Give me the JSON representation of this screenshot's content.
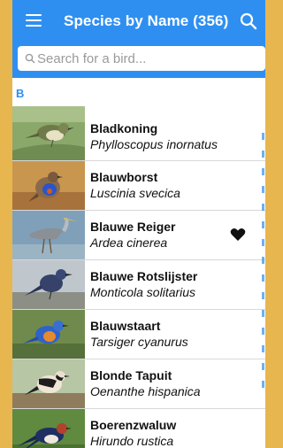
{
  "appbar": {
    "title": "Species by Name (356)",
    "menu_icon": "hamburger-menu-icon",
    "search_icon": "search-icon"
  },
  "search": {
    "placeholder": "Search for a bird..."
  },
  "section": {
    "letter": "B"
  },
  "colors": {
    "accent": "#2f8ff0",
    "background_edge": "#e8b64f"
  },
  "species": [
    {
      "name": "Bladkoning",
      "scientific": "Phylloscopus inornatus",
      "favorite": false
    },
    {
      "name": "Blauwborst",
      "scientific": "Luscinia svecica",
      "favorite": false
    },
    {
      "name": "Blauwe Reiger",
      "scientific": "Ardea cinerea",
      "favorite": true,
      "favorite_icon": "heart-icon"
    },
    {
      "name": "Blauwe Rotslijster",
      "scientific": "Monticola solitarius",
      "favorite": false
    },
    {
      "name": "Blauwstaart",
      "scientific": "Tarsiger cyanurus",
      "favorite": false
    },
    {
      "name": "Blonde Tapuit",
      "scientific": "Oenanthe hispanica",
      "favorite": false
    },
    {
      "name": "Boerenzwaluw",
      "scientific": "Hirundo rustica",
      "favorite": false
    }
  ]
}
